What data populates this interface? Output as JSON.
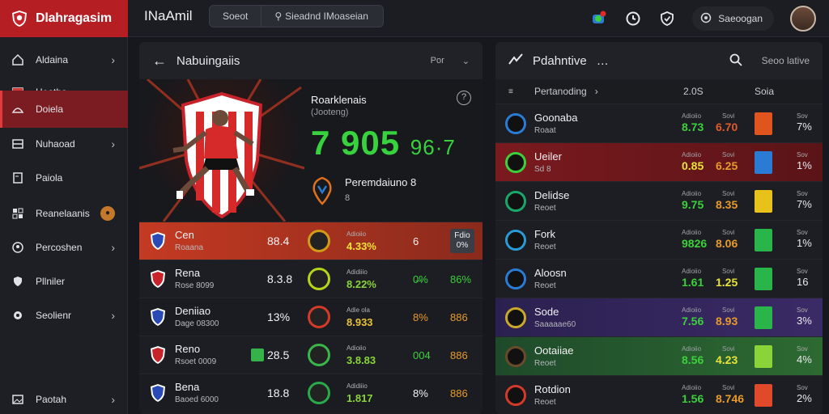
{
  "brand": {
    "title": "Dlahragasim"
  },
  "topbar": {
    "title": "INaAmil",
    "tabs": [
      "Soeot",
      "Sieadnd IMoaseian"
    ],
    "user": "Saeoogan"
  },
  "sidebar": {
    "items": [
      {
        "label": "Aldaina",
        "icon": "home-icon",
        "chevron": true
      },
      {
        "label": "Heatha",
        "icon": "calendar-icon"
      },
      {
        "label": "Doiela",
        "icon": "chart-icon",
        "active": true
      },
      {
        "label": "Nuhaoad",
        "icon": "layers-icon",
        "chevron": true
      },
      {
        "label": "Paiola",
        "icon": "document-icon"
      },
      {
        "label": "Reanelaanis",
        "icon": "grid-icon",
        "badge": ""
      },
      {
        "label": "Percoshen",
        "icon": "user-icon",
        "chevron": true
      },
      {
        "label": "Pllniler",
        "icon": "shield-icon"
      },
      {
        "label": "Seolienr",
        "icon": "gear-icon",
        "chevron": true
      },
      {
        "label": "Paotah",
        "icon": "image-icon",
        "chevron": true
      }
    ]
  },
  "left_panel": {
    "title": "Nabuingaiis",
    "header_right": "Por",
    "hero": {
      "name": "Roarklenais",
      "sub": "(Jooteng)",
      "score_main": "7 905",
      "score_small": "96·7",
      "perf_label": "Peremdaiuno",
      "perf_num": "8",
      "perf_val": "8"
    },
    "rows": [
      {
        "name": "Cen",
        "sub": "Roaana",
        "a": "88.4",
        "stat_l": "Adioiio",
        "stat": "4.33%",
        "b": "6",
        "tag_top": "Fdio",
        "tag": "0%",
        "ring": "#d39a1a",
        "highlight": true
      },
      {
        "name": "Rena",
        "sub": "Rose 8099",
        "a": "8.3.8",
        "stat_l": "Adidiiio",
        "stat": "8.22%",
        "b": "0̶%",
        "c": "86%",
        "ring": "#b5d41a"
      },
      {
        "name": "Deniiao",
        "sub": "Dage 08300",
        "a": "13%",
        "stat_l": "Adie ola",
        "stat": "8.933",
        "b": "8%",
        "c": "886",
        "ring": "#d43a2a"
      },
      {
        "name": "Reno",
        "sub": "Rsoet 0009",
        "a": "28.5",
        "stat_l": "Adioiio",
        "stat": "3.8.83",
        "b": "004",
        "c": "886",
        "ring": "#3ab54a",
        "pill": true
      },
      {
        "name": "Bena",
        "sub": "Baoed 6000",
        "a": "18.8",
        "stat_l": "Adidiiio",
        "stat": "1.817",
        "b": "8%",
        "c": "886",
        "ring": "#2aa84a"
      }
    ]
  },
  "right_panel": {
    "title": "Pdahntive",
    "search": "Seoo lative",
    "sub_cols": [
      "Pertanoding",
      "2.0S",
      "Soia"
    ],
    "rows": [
      {
        "name": "Goonaba",
        "sub": "Roaat",
        "l1": "Adioiio",
        "v1": "8.73",
        "l2": "Sovi",
        "v2": "6.70",
        "bar": "#e0541e",
        "pl": "Sov",
        "pct": "7%",
        "ico": "#2a7bd4",
        "c1": "#3cd03c",
        "c2": "#e05a2a"
      },
      {
        "name": "Ueiler",
        "sub": "Sd 8",
        "l1": "Adioiio",
        "v1": "0.85",
        "l2": "Sovi",
        "v2": "6.25",
        "bar": "#2a7bd4",
        "pl": "Sov",
        "pct": "1%",
        "ico": "#3cd03c",
        "c1": "#e8e23a",
        "c2": "#e89a2a",
        "style": "red"
      },
      {
        "name": "Delidse",
        "sub": "Reoet",
        "l1": "Adioiio",
        "v1": "9.75",
        "l2": "Sovi",
        "v2": "8.35",
        "bar": "#e8c21a",
        "pl": "Sov",
        "pct": "7%",
        "ico": "#1aa86a",
        "c1": "#3cd03c",
        "c2": "#e89a2a"
      },
      {
        "name": "Fork",
        "sub": "Reoet",
        "l1": "Adioiio",
        "v1": "9826",
        "l2": "Sovi",
        "v2": "8.06",
        "bar": "#2ab54a",
        "pl": "Sov",
        "pct": "1%",
        "ico": "#2a9ad4",
        "c1": "#3cd03c",
        "c2": "#e89a2a"
      },
      {
        "name": "Aloosn",
        "sub": "Reoet",
        "l1": "Adioiio",
        "v1": "1.61",
        "l2": "Sovi",
        "v2": "1.25",
        "bar": "#2ab54a",
        "pl": "Sov",
        "pct": "16",
        "ico": "#2a7bd4",
        "c1": "#3cd03c",
        "c2": "#e8e23a"
      },
      {
        "name": "Sode",
        "sub": "Saaaaae60",
        "l1": "Adioiio",
        "v1": "7.56",
        "l2": "Sovi",
        "v2": "8.93",
        "bar": "#2ab54a",
        "pl": "Sov",
        "pct": "3%",
        "ico": "#c9a82a",
        "c1": "#3cd03c",
        "c2": "#e89a2a",
        "style": "purple"
      },
      {
        "name": "Ootaiiae",
        "sub": "Reoet",
        "l1": "Adioiio",
        "v1": "8.56",
        "l2": "Sovi",
        "v2": "4.23",
        "bar": "#8ad43a",
        "pl": "Sov",
        "pct": "4%",
        "ico": "#6a4a2a",
        "c1": "#3cd03c",
        "c2": "#e8e23a",
        "style": "green"
      },
      {
        "name": "Rotdion",
        "sub": "Reoet",
        "l1": "Adioiio",
        "v1": "1.56",
        "l2": "Sovi",
        "v2": "8.746",
        "bar": "#e04a2a",
        "pl": "Sov",
        "pct": "2%",
        "ico": "#d43a2a",
        "c1": "#3cd03c",
        "c2": "#e89a2a"
      }
    ]
  }
}
